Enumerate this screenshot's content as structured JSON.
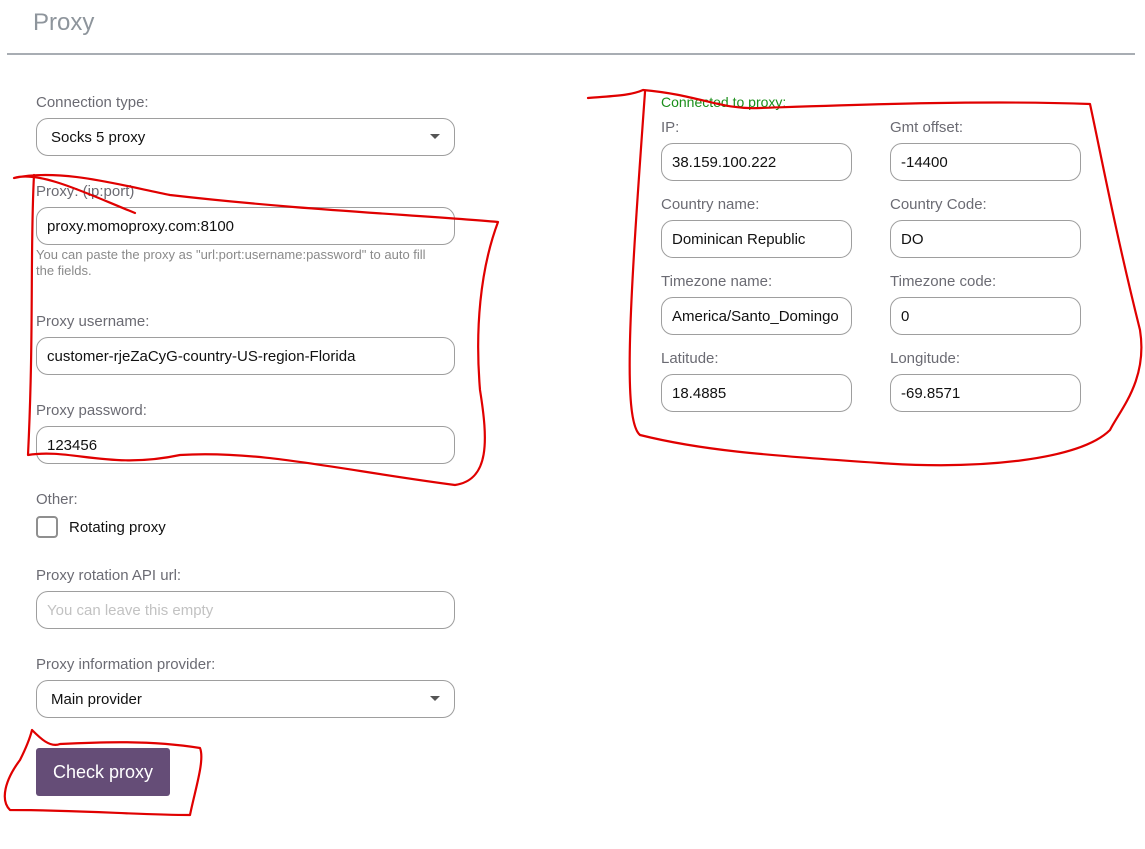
{
  "page": {
    "title": "Proxy"
  },
  "left_form": {
    "connection_type": {
      "label": "Connection type:",
      "value": "Socks 5 proxy"
    },
    "proxy": {
      "label": "Proxy: (ip:port)",
      "value": "proxy.momoproxy.com:8100",
      "hint": "You can paste the proxy as \"url:port:username:password\" to auto fill the fields."
    },
    "username": {
      "label": "Proxy username:",
      "value": "customer-rjeZaCyG-country-US-region-Florida"
    },
    "password": {
      "label": "Proxy password:",
      "value": "123456"
    },
    "other": {
      "label": "Other:",
      "rotating_proxy": {
        "label": "Rotating proxy",
        "checked": false
      }
    },
    "rotation_api": {
      "label": "Proxy rotation API url:",
      "value": "",
      "placeholder": "You can leave this empty"
    },
    "info_provider": {
      "label": "Proxy information provider:",
      "value": "Main provider"
    },
    "check_button": {
      "label": "Check proxy"
    }
  },
  "result_panel": {
    "status": "Connected to proxy:",
    "status_color": "#1a8f1a",
    "fields": {
      "ip": {
        "label": "IP:",
        "value": "38.159.100.222"
      },
      "gmt_offset": {
        "label": "Gmt offset:",
        "value": "-14400"
      },
      "country_name": {
        "label": "Country name:",
        "value": "Dominican Republic"
      },
      "country_code": {
        "label": "Country Code:",
        "value": "DO"
      },
      "timezone_name": {
        "label": "Timezone name:",
        "value": "America/Santo_Domingo"
      },
      "timezone_code": {
        "label": "Timezone code:",
        "value": "0"
      },
      "latitude": {
        "label": "Latitude:",
        "value": "18.4885"
      },
      "longitude": {
        "label": "Longitude:",
        "value": "-69.8571"
      }
    }
  },
  "colors": {
    "button_bg": "#654d77",
    "annotation": "#e00000"
  }
}
